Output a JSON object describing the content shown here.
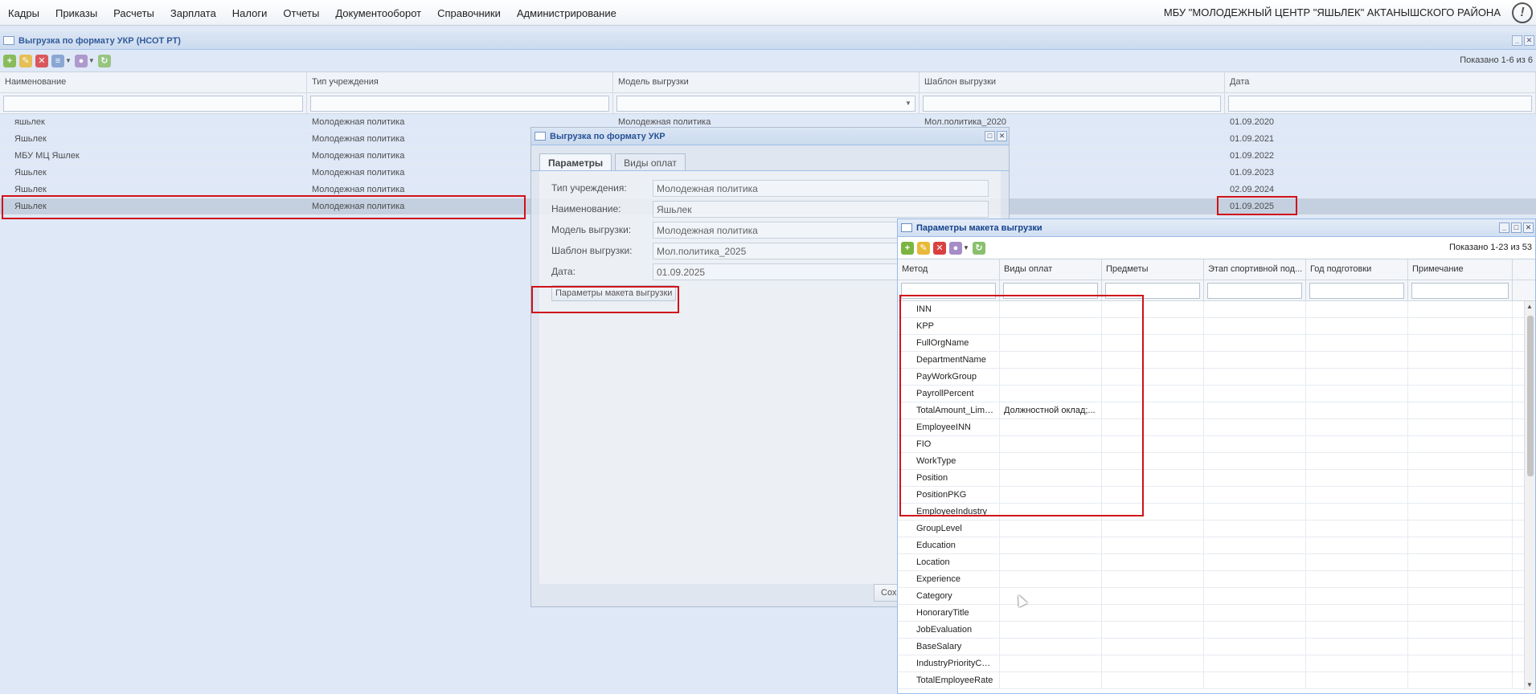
{
  "topbar": {
    "menu": [
      "Кадры",
      "Приказы",
      "Расчеты",
      "Зарплата",
      "Налоги",
      "Отчеты",
      "Документооборот",
      "Справочники",
      "Администрирование"
    ],
    "org": "МБУ \"МОЛОДЕЖНЫЙ ЦЕНТР \"ЯШЬЛЕК\" АКТАНЫШСКОГО РАЙОНА",
    "help_icon": "help-icon"
  },
  "main": {
    "title": "Выгрузка по формату УКР (НСОТ РТ)",
    "count": "Показано 1-6 из 6",
    "columns": [
      "Наименование",
      "Тип учреждения",
      "Модель выгрузки",
      "Шаблон выгрузки",
      "Дата"
    ],
    "rows": [
      {
        "name": "яшьлек",
        "type": "Молодежная политика",
        "model": "Молодежная политика",
        "template": "Мол.политика_2020",
        "date": "01.09.2020"
      },
      {
        "name": "Яшьлек",
        "type": "Молодежная политика",
        "model": "",
        "template": "",
        "date": "01.09.2021"
      },
      {
        "name": "МБУ МЦ Яшлек",
        "type": "Молодежная политика",
        "model": "",
        "template": "",
        "date": "01.09.2022"
      },
      {
        "name": "Яшьлек",
        "type": "Молодежная политика",
        "model": "",
        "template": "",
        "date": "01.09.2023"
      },
      {
        "name": "Яшьлек",
        "type": "Молодежная политика",
        "model": "",
        "template": "",
        "date": "02.09.2024"
      },
      {
        "name": "Яшьлек",
        "type": "Молодежная политика",
        "model": "",
        "template": "",
        "date": "01.09.2025"
      }
    ]
  },
  "dialog": {
    "title": "Выгрузка по формату УКР",
    "tabs": [
      "Параметры",
      "Виды оплат"
    ],
    "fields": [
      {
        "label": "Тип учреждения:",
        "value": "Молодежная политика"
      },
      {
        "label": "Наименование:",
        "value": "Яшьлек"
      },
      {
        "label": "Модель выгрузки:",
        "value": "Молодежная политика"
      },
      {
        "label": "Шаблон выгрузки:",
        "value": "Мол.политика_2025"
      },
      {
        "label": "Дата:",
        "value": "01.09.2025"
      }
    ],
    "params_button": "Параметры макета выгрузки",
    "save_button": "Сох"
  },
  "params": {
    "title": "Параметры макета выгрузки",
    "count": "Показано 1-23 из 53",
    "columns": [
      "Метод",
      "Виды оплат",
      "Предметы",
      "Этап спортивной под...",
      "Год подготовки",
      "Примечание"
    ],
    "rows": [
      {
        "method": "INN",
        "pay": ""
      },
      {
        "method": "KPP",
        "pay": ""
      },
      {
        "method": "FullOrgName",
        "pay": ""
      },
      {
        "method": "DepartmentName",
        "pay": ""
      },
      {
        "method": "PayWorkGroup",
        "pay": ""
      },
      {
        "method": "PayrollPercent",
        "pay": ""
      },
      {
        "method": "TotalAmount_Limited",
        "pay": "Должностной оклад;..."
      },
      {
        "method": "EmployeeINN",
        "pay": ""
      },
      {
        "method": "FIO",
        "pay": ""
      },
      {
        "method": "WorkType",
        "pay": ""
      },
      {
        "method": "Position",
        "pay": ""
      },
      {
        "method": "PositionPKG",
        "pay": ""
      },
      {
        "method": "EmployeeIndustry",
        "pay": ""
      },
      {
        "method": "GroupLevel",
        "pay": ""
      },
      {
        "method": "Education",
        "pay": ""
      },
      {
        "method": "Location",
        "pay": ""
      },
      {
        "method": "Experience",
        "pay": ""
      },
      {
        "method": "Category",
        "pay": ""
      },
      {
        "method": "HonoraryTitle",
        "pay": ""
      },
      {
        "method": "JobEvaluation",
        "pay": ""
      },
      {
        "method": "BaseSalary",
        "pay": ""
      },
      {
        "method": "IndustryPriorityCoef...",
        "pay": ""
      },
      {
        "method": "TotalEmployeeRate",
        "pay": ""
      }
    ]
  },
  "colors": {
    "highlight": "#d0121a",
    "selected_row": "#c0ccdb",
    "title_text": "#15428b"
  }
}
